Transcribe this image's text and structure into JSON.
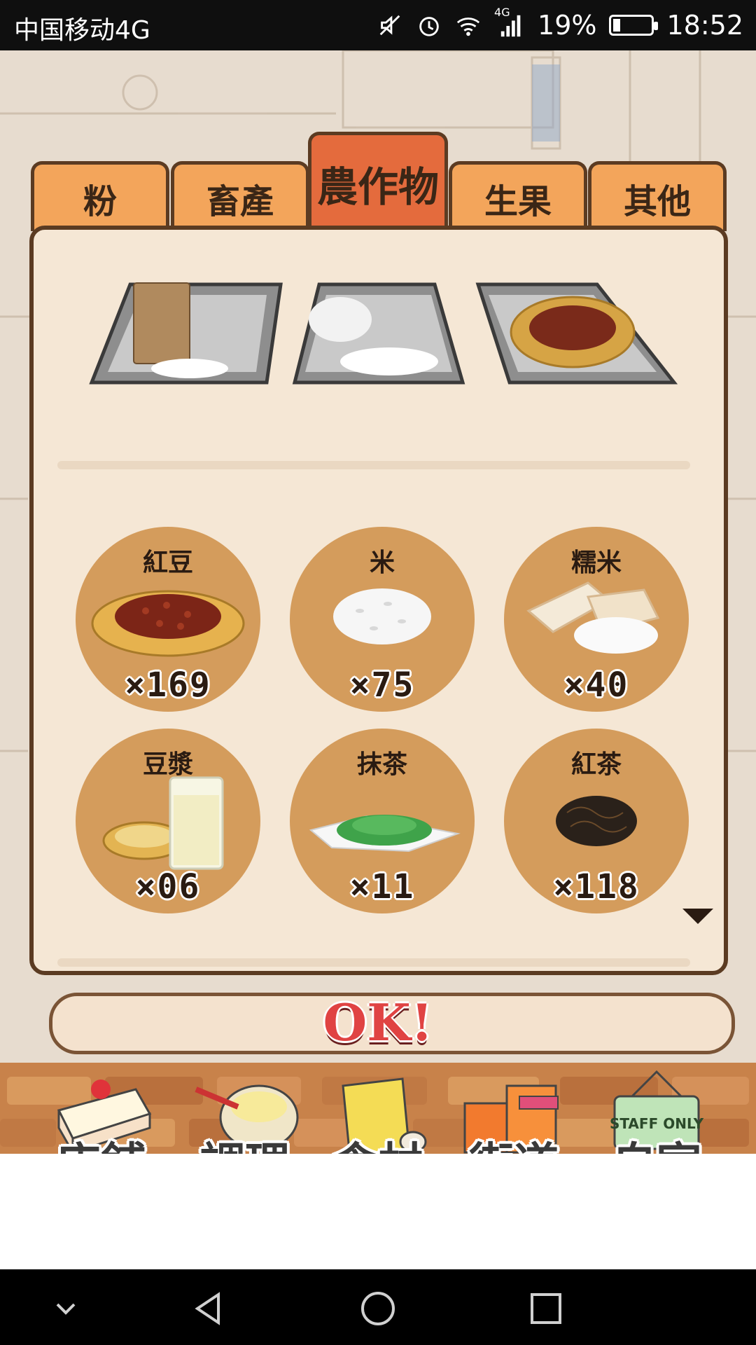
{
  "status_bar": {
    "carrier": "中国移动4G",
    "network_badge": "4G",
    "battery": "19%",
    "battery_fraction": 0.19,
    "time": "18:52",
    "icons": [
      "mute-icon",
      "alarm-icon",
      "wifi-icon",
      "signal-icon",
      "battery-icon"
    ]
  },
  "tabs": [
    {
      "label": "粉",
      "active": false
    },
    {
      "label": "畜產",
      "active": false
    },
    {
      "label": "農作物",
      "active": true
    },
    {
      "label": "生果",
      "active": false
    },
    {
      "label": "其他",
      "active": false
    }
  ],
  "trays": [
    "flour-bag-tray",
    "rice-tray",
    "red-bean-tray"
  ],
  "ingredients": [
    {
      "name": "紅豆",
      "count": "×169",
      "icon": "red-bean-icon"
    },
    {
      "name": "米",
      "count": "×75",
      "icon": "rice-icon"
    },
    {
      "name": "糯米",
      "count": "×40",
      "icon": "glutinous-rice-icon"
    },
    {
      "name": "豆漿",
      "count": "×06",
      "icon": "soy-milk-icon"
    },
    {
      "name": "抹茶",
      "count": "×11",
      "icon": "matcha-icon"
    },
    {
      "name": "紅茶",
      "count": "×118",
      "icon": "black-tea-icon"
    }
  ],
  "ok_label": "OK!",
  "nav": [
    {
      "label": "店鋪",
      "icon": "cake-icon"
    },
    {
      "label": "調理",
      "icon": "mixing-bowl-icon"
    },
    {
      "label": "食材",
      "icon": "ingredient-bag-icon"
    },
    {
      "label": "街道",
      "icon": "shop-street-icon"
    },
    {
      "label": "自室",
      "icon": "staff-only-sign-icon",
      "sign_text": "STAFF ONLY"
    }
  ],
  "colors": {
    "tab": "#f3a55b",
    "tab_active": "#e46b3d",
    "panel": "#f5e7d5",
    "item_circle": "#d49c5c",
    "ok_text": "#e04343"
  }
}
